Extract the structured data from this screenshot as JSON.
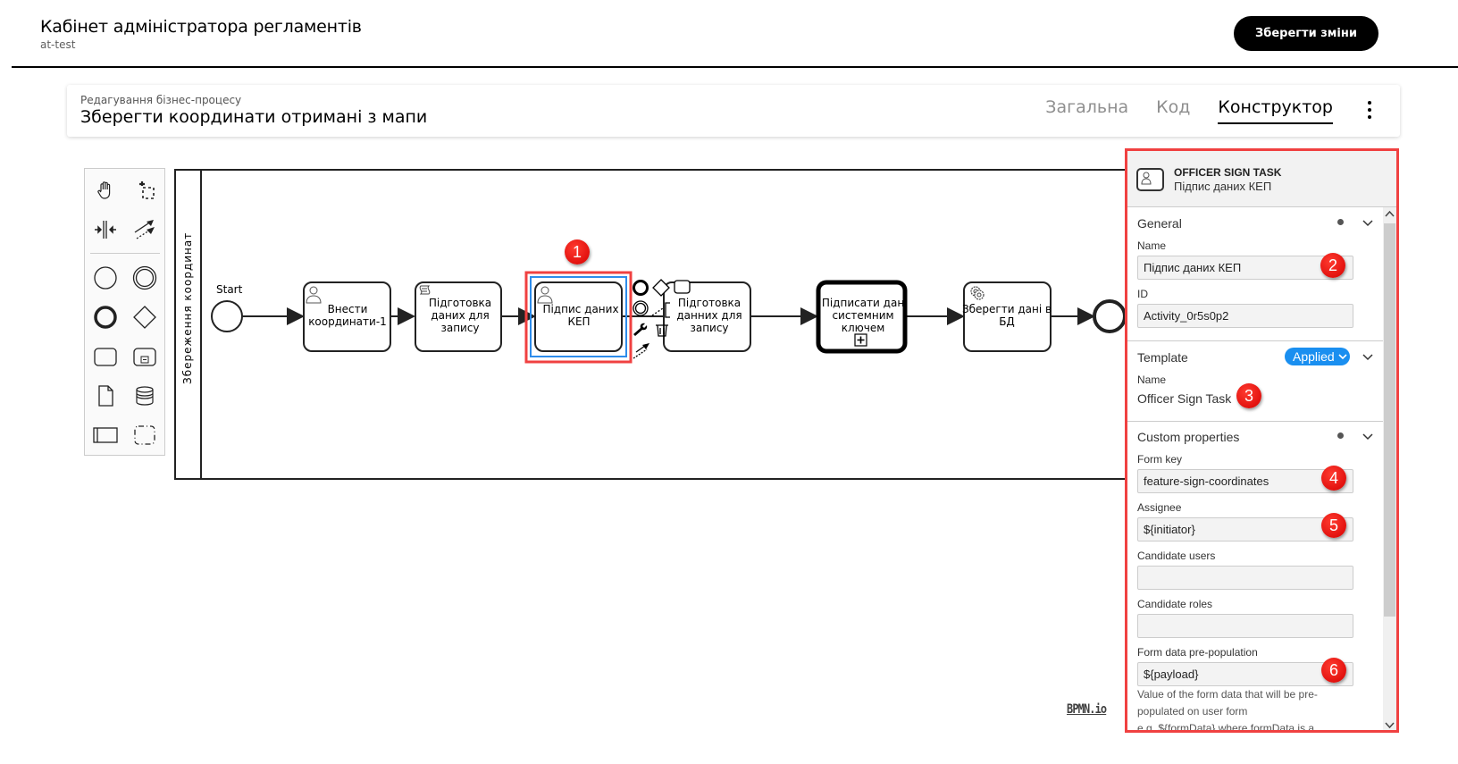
{
  "header": {
    "title": "Кабінет адміністратора регламентів",
    "subtitle": "at-test",
    "save_label": "Зберегти зміни"
  },
  "process": {
    "caption": "Редагування бізнес-процесу",
    "title": "Зберегти координати отримані з мапи",
    "tabs": [
      {
        "label": "Загальна",
        "active": false
      },
      {
        "label": "Код",
        "active": false
      },
      {
        "label": "Конструктор",
        "active": true
      }
    ],
    "menu_icon": "kebab-menu-icon"
  },
  "palette": {
    "tools": [
      "hand-tool-icon",
      "lasso-tool-icon",
      "space-tool-icon",
      "global-connect-icon"
    ],
    "shapes": [
      "start-event-icon",
      "intermediate-event-icon",
      "end-event-icon",
      "gateway-icon",
      "task-icon",
      "subprocess-icon",
      "data-object-icon",
      "data-store-icon",
      "pool-icon",
      "group-icon"
    ]
  },
  "diagram": {
    "lane_label": "Збереження координат",
    "start_label": "Start",
    "tasks": [
      {
        "label_lines": [
          "Внести",
          "координати-1"
        ],
        "icon": "user-icon"
      },
      {
        "label_lines": [
          "Підготовка",
          "даних для",
          "запису"
        ],
        "icon": "script-icon"
      },
      {
        "label_lines": [
          "Підпис даних",
          "КЕП"
        ],
        "icon": "user-icon",
        "selected": true
      },
      {
        "label_lines": [
          "Підготовка",
          "данних для",
          "запису"
        ],
        "icon": "none"
      },
      {
        "label_lines": [
          "Підписати дан",
          "системним",
          "ключем"
        ],
        "icon": "call-activity-icon"
      },
      {
        "label_lines": [
          "Зберегти дані в",
          "БД"
        ],
        "icon": "service-gear-icon"
      }
    ],
    "context_pad": [
      "append-end-event-icon",
      "append-gateway-icon",
      "append-task-icon",
      "append-intermediate-event-icon",
      "text-annotation-icon",
      "change-type-wrench-icon",
      "delete-trash-icon",
      "connect-arrow-icon"
    ],
    "watermark": "BPMN.io"
  },
  "badges": [
    "1",
    "2",
    "3",
    "4",
    "5",
    "6"
  ],
  "properties": {
    "element_type": "OFFICER SIGN TASK",
    "element_name": "Підпис даних КЕП",
    "general": {
      "title": "General",
      "name_label": "Name",
      "name_value": "Підпис даних КЕП",
      "id_label": "ID",
      "id_value": "Activity_0r5s0p2"
    },
    "template": {
      "title": "Template",
      "status": "Applied",
      "name_label": "Name",
      "name_value": "Officer Sign Task"
    },
    "custom": {
      "title": "Custom properties",
      "form_key_label": "Form key",
      "form_key_value": "feature-sign-coordinates",
      "assignee_label": "Assignee",
      "assignee_value": "${initiator}",
      "candidate_users_label": "Candidate users",
      "candidate_users_value": "",
      "candidate_roles_label": "Candidate roles",
      "candidate_roles_value": "",
      "form_data_label": "Form data pre-population",
      "form_data_value": "${payload}",
      "form_data_help_1": "Value of the form data that will be pre-",
      "form_data_help_2": "populated on user form",
      "form_data_help_3": "e.g. ${formData} where formData is a"
    }
  },
  "colors": {
    "highlight_red": "#f04141",
    "selection_blue": "#2d8ceb",
    "applied_blue": "#1a8ff0",
    "badge_red": "#e30000"
  }
}
